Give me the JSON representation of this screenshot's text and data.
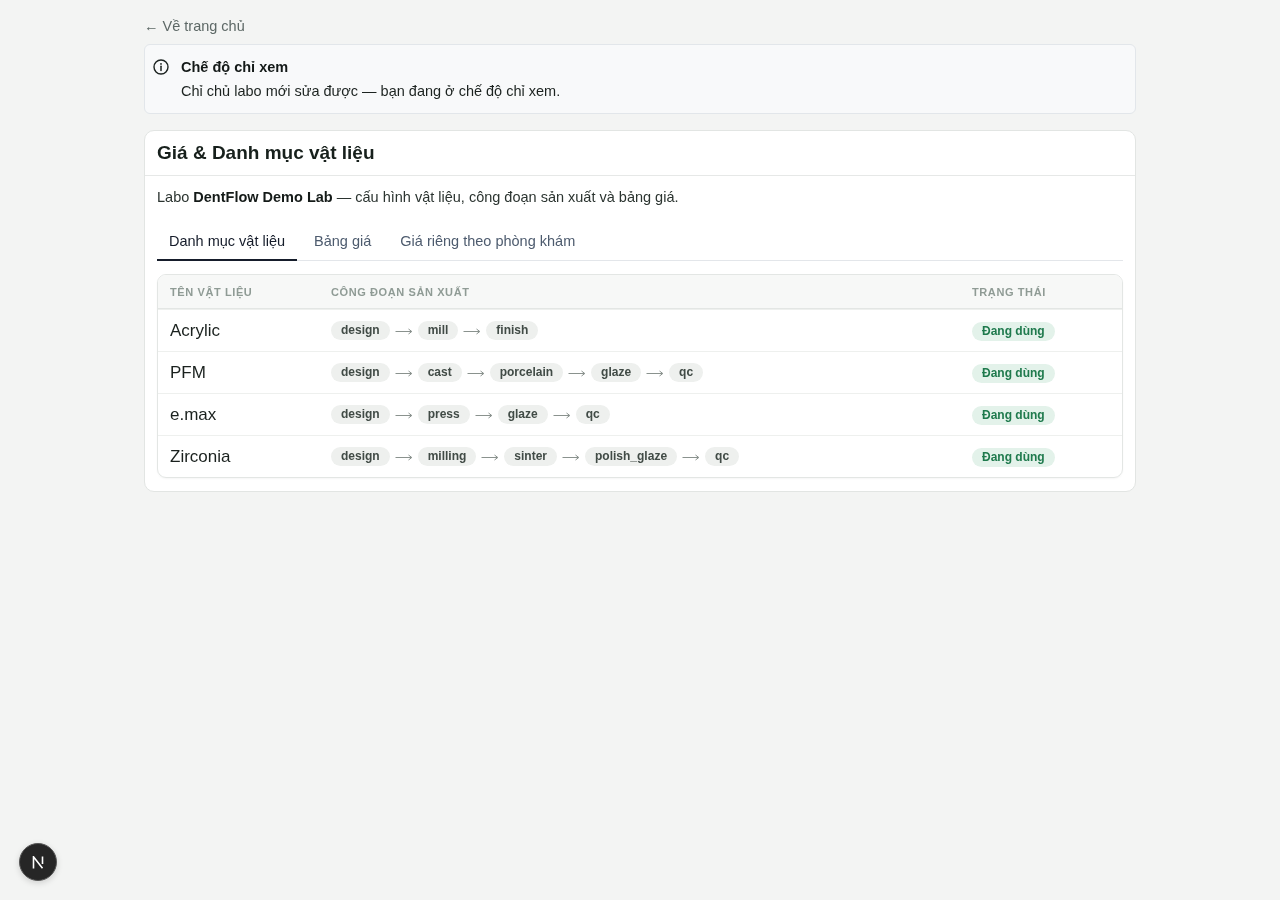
{
  "back_link": {
    "label": "← Về trang chủ"
  },
  "notice": {
    "title": "Chế độ chỉ xem",
    "message": "Chỉ chủ labo mới sửa được — bạn đang ở chế độ chỉ xem."
  },
  "card": {
    "title": "Giá & Danh mục vật liệu",
    "description": "Labo **DentFlow Demo Lab** — cấu hình vật liệu, công đoạn sản xuất và bảng giá.",
    "tabs": [
      {
        "label": "Danh mục vật liệu",
        "selected": true
      },
      {
        "label": "Bảng giá",
        "selected": false
      },
      {
        "label": "Giá riêng theo phòng khám",
        "selected": false
      }
    ],
    "table": {
      "columns": [
        "TÊN VẬT LIỆU",
        "CÔNG ĐOẠN SẢN XUẤT",
        "TRẠNG THÁI"
      ],
      "rows": [
        {
          "name": "Acrylic",
          "stages": [
            "design",
            "mill",
            "finish"
          ],
          "status": "Đang dùng"
        },
        {
          "name": "PFM",
          "stages": [
            "design",
            "cast",
            "porcelain",
            "glaze",
            "qc"
          ],
          "status": "Đang dùng"
        },
        {
          "name": "e.max",
          "stages": [
            "design",
            "press",
            "glaze",
            "qc"
          ],
          "status": "Đang dùng"
        },
        {
          "name": "Zirconia",
          "stages": [
            "design",
            "milling",
            "sinter",
            "polish_glaze",
            "qc"
          ],
          "status": "Đang dùng"
        }
      ]
    }
  }
}
